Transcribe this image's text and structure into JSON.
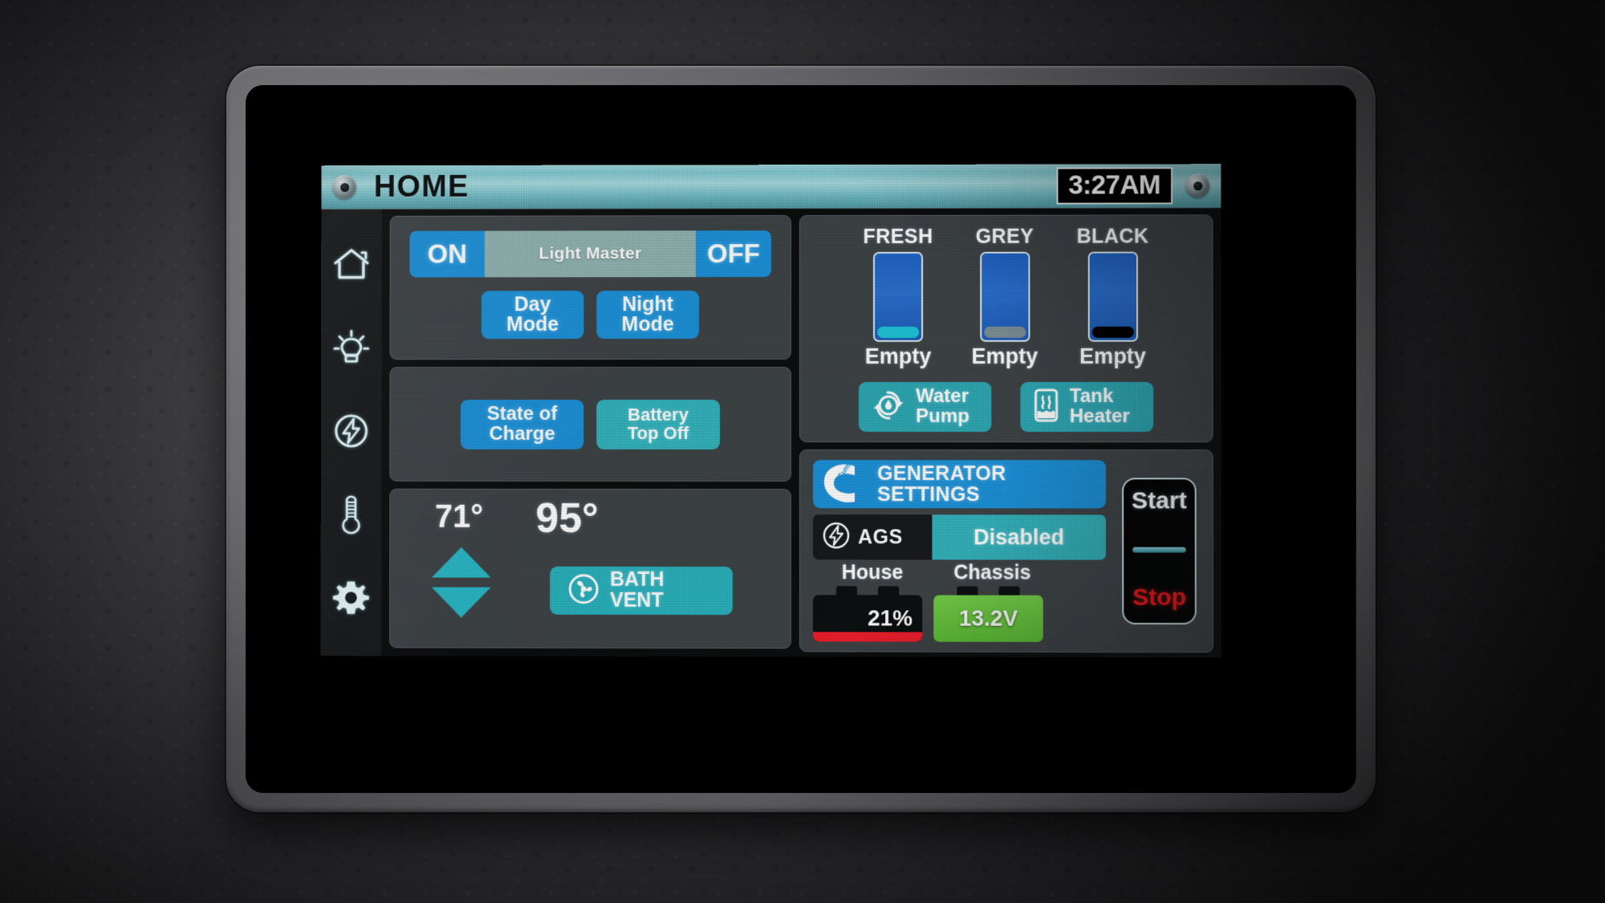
{
  "header": {
    "title": "HOME",
    "clock": "3:27AM",
    "screw_left_icon": "screw-icon",
    "screw_right_icon": "screw-icon"
  },
  "sidebar": {
    "items": [
      {
        "id": "home",
        "icon": "house-icon",
        "label": "Home"
      },
      {
        "id": "lights",
        "icon": "light-bulb-icon",
        "label": "Lights"
      },
      {
        "id": "power",
        "icon": "power-lightning-icon",
        "label": "Power"
      },
      {
        "id": "climate",
        "icon": "thermometer-icon",
        "label": "Climate"
      },
      {
        "id": "settings",
        "icon": "gear-icon",
        "label": "Settings"
      }
    ]
  },
  "lights": {
    "on_label": "ON",
    "master_label": "Light Master",
    "off_label": "OFF",
    "day_mode_line1": "Day",
    "day_mode_line2": "Mode",
    "night_mode_line1": "Night",
    "night_mode_line2": "Mode"
  },
  "battery_panel": {
    "soc_line1": "State of",
    "soc_line2": "Charge",
    "topoff_line1": "Battery",
    "topoff_line2": "Top Off"
  },
  "climate": {
    "inside_temp": "71°",
    "outside_temp": "95°",
    "up_icon": "triangle-up-icon",
    "down_icon": "triangle-down-icon",
    "bath_vent_line1": "BATH",
    "bath_vent_line2": "VENT",
    "bath_vent_icon": "fan-icon"
  },
  "tanks": {
    "gauges": [
      {
        "name": "FRESH",
        "status": "Empty",
        "fill_color": "#1ec5d8",
        "level_percent": 8
      },
      {
        "name": "GREY",
        "status": "Empty",
        "fill_color": "#7d8f96",
        "level_percent": 8
      },
      {
        "name": "BLACK",
        "status": "Empty",
        "fill_color": "#000000",
        "level_percent": 8
      }
    ],
    "water_pump_line1": "Water",
    "water_pump_line2": "Pump",
    "water_pump_icon": "water-pump-icon",
    "tank_heater_line1": "Tank",
    "tank_heater_line2": "Heater",
    "tank_heater_icon": "tank-heater-icon"
  },
  "generator": {
    "brand_icon": "cummins-logo-icon",
    "settings_line1": "GENERATOR",
    "settings_line2": "SETTINGS",
    "ags_icon": "power-lightning-icon",
    "ags_label": "AGS",
    "ags_state": "Disabled",
    "house_label": "House",
    "chassis_label": "Chassis",
    "house_value": "21%",
    "house_level_percent": 21,
    "chassis_value": "13.2V",
    "start_label": "Start",
    "stop_label": "Stop"
  },
  "colors": {
    "accent_blue": "#1b90d8",
    "accent_teal": "#2fb4bd",
    "alert_red": "#ee1d2b",
    "ok_green": "#5cbf35",
    "titlebar_teal": "#7fc9d2"
  }
}
